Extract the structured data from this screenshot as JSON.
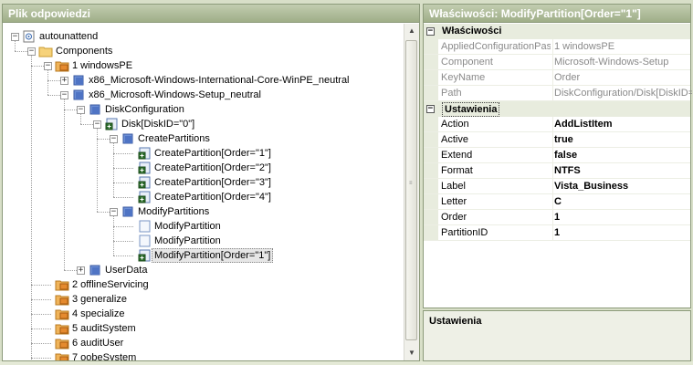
{
  "left_panel": {
    "title": "Plik odpowiedzi"
  },
  "right_panel": {
    "title": "Właściwości: ModifyPartition[Order=\"1\"]"
  },
  "tree": [
    {
      "label": "autounattend",
      "icon": "answer-file-icon",
      "level": 0,
      "toggle": "-"
    },
    {
      "label": "Components",
      "icon": "folder-icon",
      "level": 1,
      "toggle": "-"
    },
    {
      "label": "1 windowsPE",
      "icon": "pass-icon",
      "level": 2,
      "toggle": "-"
    },
    {
      "label": "x86_Microsoft-Windows-International-Core-WinPE_neutral",
      "icon": "component-icon",
      "level": 3,
      "toggle": "+"
    },
    {
      "label": "x86_Microsoft-Windows-Setup_neutral",
      "icon": "component-icon",
      "level": 3,
      "toggle": "-"
    },
    {
      "label": "DiskConfiguration",
      "icon": "component-icon",
      "level": 4,
      "toggle": "-"
    },
    {
      "label": "Disk[DiskID=\"0\"]",
      "icon": "list-item-icon",
      "level": 5,
      "toggle": "-"
    },
    {
      "label": "CreatePartitions",
      "icon": "component-icon",
      "level": 6,
      "toggle": "-"
    },
    {
      "label": "CreatePartition[Order=\"1\"]",
      "icon": "list-item-icon",
      "level": 7,
      "toggle": ""
    },
    {
      "label": "CreatePartition[Order=\"2\"]",
      "icon": "list-item-icon",
      "level": 7,
      "toggle": ""
    },
    {
      "label": "CreatePartition[Order=\"3\"]",
      "icon": "list-item-icon",
      "level": 7,
      "toggle": ""
    },
    {
      "label": "CreatePartition[Order=\"4\"]",
      "icon": "list-item-icon",
      "level": 7,
      "toggle": ""
    },
    {
      "label": "ModifyPartitions",
      "icon": "component-icon",
      "level": 6,
      "toggle": "-"
    },
    {
      "label": "ModifyPartition",
      "icon": "empty-item-icon",
      "level": 7,
      "toggle": ""
    },
    {
      "label": "ModifyPartition",
      "icon": "empty-item-icon",
      "level": 7,
      "toggle": ""
    },
    {
      "label": "ModifyPartition[Order=\"1\"]",
      "icon": "list-item-icon",
      "level": 7,
      "toggle": "",
      "selected": true
    },
    {
      "label": "UserData",
      "icon": "component-icon",
      "level": 4,
      "toggle": "+"
    },
    {
      "label": "2 offlineServicing",
      "icon": "pass-icon",
      "level": 2,
      "toggle": ""
    },
    {
      "label": "3 generalize",
      "icon": "pass-icon",
      "level": 2,
      "toggle": ""
    },
    {
      "label": "4 specialize",
      "icon": "pass-icon",
      "level": 2,
      "toggle": ""
    },
    {
      "label": "5 auditSystem",
      "icon": "pass-icon",
      "level": 2,
      "toggle": ""
    },
    {
      "label": "6 auditUser",
      "icon": "pass-icon",
      "level": 2,
      "toggle": ""
    },
    {
      "label": "7 oobeSystem",
      "icon": "pass-icon",
      "level": 2,
      "toggle": ""
    }
  ],
  "properties": {
    "category1": "Właściwości",
    "readonly_rows": [
      {
        "name": "AppliedConfigurationPass",
        "value": "1 windowsPE"
      },
      {
        "name": "Component",
        "value": "Microsoft-Windows-Setup"
      },
      {
        "name": "KeyName",
        "value": "Order"
      },
      {
        "name": "Path",
        "value": "DiskConfiguration/Disk[DiskID="
      }
    ],
    "category2": "Ustawienia",
    "setting_rows": [
      {
        "name": "Action",
        "value": "AddListItem"
      },
      {
        "name": "Active",
        "value": "true"
      },
      {
        "name": "Extend",
        "value": "false"
      },
      {
        "name": "Format",
        "value": "NTFS"
      },
      {
        "name": "Label",
        "value": "Vista_Business"
      },
      {
        "name": "Letter",
        "value": "C"
      },
      {
        "name": "Order",
        "value": "1"
      },
      {
        "name": "PartitionID",
        "value": "1"
      }
    ]
  },
  "description": {
    "title": "Ustawienia"
  }
}
